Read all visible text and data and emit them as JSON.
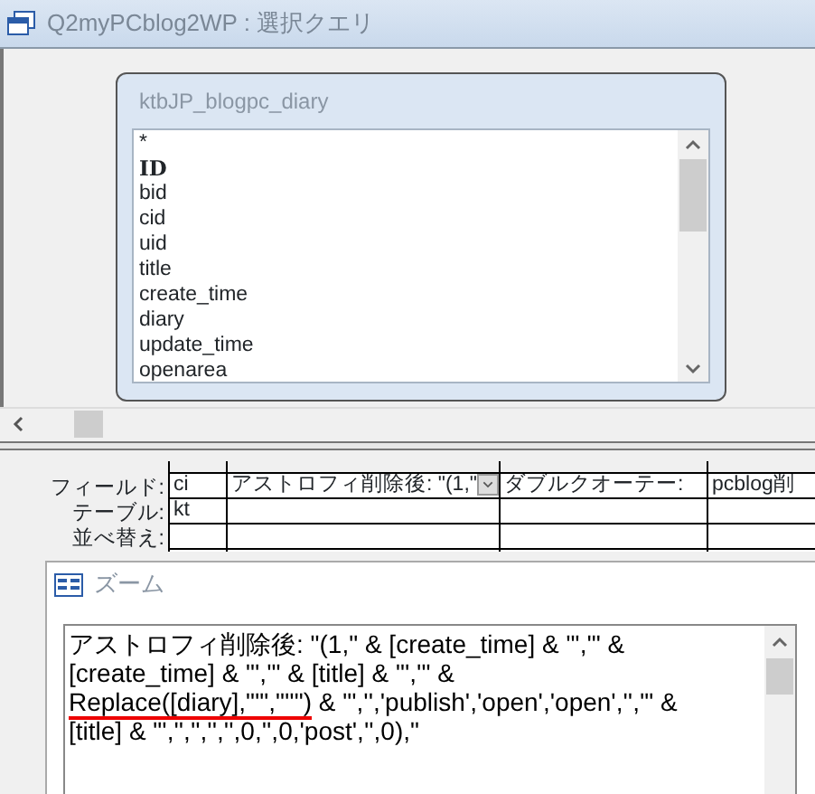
{
  "window": {
    "title": "Q2myPCblog2WP : 選択クエリ"
  },
  "field_list": {
    "title": "ktbJP_blogpc_diary",
    "fields": [
      {
        "name": "*",
        "kind": "plain"
      },
      {
        "name": "ID",
        "kind": "key"
      },
      {
        "name": "bid",
        "kind": "plain"
      },
      {
        "name": "cid",
        "kind": "plain"
      },
      {
        "name": "uid",
        "kind": "plain"
      },
      {
        "name": "title",
        "kind": "plain"
      },
      {
        "name": "create_time",
        "kind": "plain"
      },
      {
        "name": "diary",
        "kind": "plain"
      },
      {
        "name": "update_time",
        "kind": "plain"
      },
      {
        "name": "openarea",
        "kind": "plain"
      }
    ]
  },
  "grid": {
    "row_labels": [
      "フィールド:",
      "テーブル:",
      "並べ替え:"
    ],
    "columns": [
      {
        "field": "ci",
        "table": "kt",
        "dropdown": false
      },
      {
        "field": "アストロフィ削除後: \"(1,\"",
        "dropdown": true
      },
      {
        "field": "ダブルクオーテー:",
        "dropdown": false
      },
      {
        "field": "pcblog削",
        "dropdown": false
      }
    ]
  },
  "zoom": {
    "title": "ズーム",
    "parts": [
      {
        "text": "アストロフィ削除後: \"(1,\" & [create_time] & \"','\" &\n[create_time] & \"','\" & [title] & \"','\" &\n",
        "underlined": false
      },
      {
        "text": "Replace([diary],\"'\",\"''\")",
        "underlined": true
      },
      {
        "text": " & \"','','publish','open','open','','\" &\n[title] & \"','','','','',0,'',0,'post','',0),\"",
        "underlined": false
      }
    ]
  }
}
